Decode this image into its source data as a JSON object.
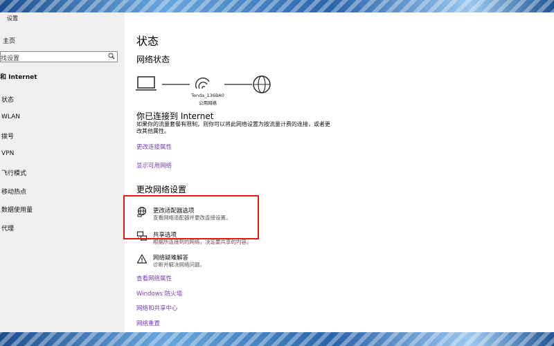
{
  "sidebar": {
    "window_title": "设置",
    "home": "主页",
    "search_placeholder": "找设置",
    "section": "和 Internet",
    "items": [
      {
        "label": "状态"
      },
      {
        "label": "WLAN"
      },
      {
        "label": "拨号"
      },
      {
        "label": "VPN"
      },
      {
        "label": "飞行模式"
      },
      {
        "label": "移动热点"
      },
      {
        "label": "数据使用量"
      },
      {
        "label": "代理"
      }
    ]
  },
  "main": {
    "title": "状态",
    "network_status_heading": "网络状态",
    "network": {
      "ssid": "Tenda_136BA0",
      "type": "公用网络"
    },
    "connected_title": "你已连接到 Internet",
    "connected_desc": "如果你的流量套餐有限制，则你可以将此网络设置为按流量计费的连接，或者更改其他属性。",
    "links_top": [
      {
        "label": "更改连接属性"
      },
      {
        "label": "显示可用网络"
      }
    ],
    "change_heading": "更改网络设置",
    "options": [
      {
        "title": "更改适配器选项",
        "desc": "查看网络适配器并更改连接设置。",
        "icon": "globe-network-icon"
      },
      {
        "title": "共享选项",
        "desc": "根据所连接到的网络，决定要共享的内容。",
        "icon": "sharing-icon"
      },
      {
        "title": "网络疑难解答",
        "desc": "诊断并解决网络问题。",
        "icon": "warning-icon"
      }
    ],
    "links_bottom": [
      {
        "label": "查看网络属性"
      },
      {
        "label": "Windows 防火墙"
      },
      {
        "label": "网络和共享中心"
      },
      {
        "label": "网络重置"
      }
    ]
  },
  "colors": {
    "link": "#7a3fb0",
    "highlight": "#e01a1a",
    "sidebar_bg": "#f0f0f0"
  }
}
